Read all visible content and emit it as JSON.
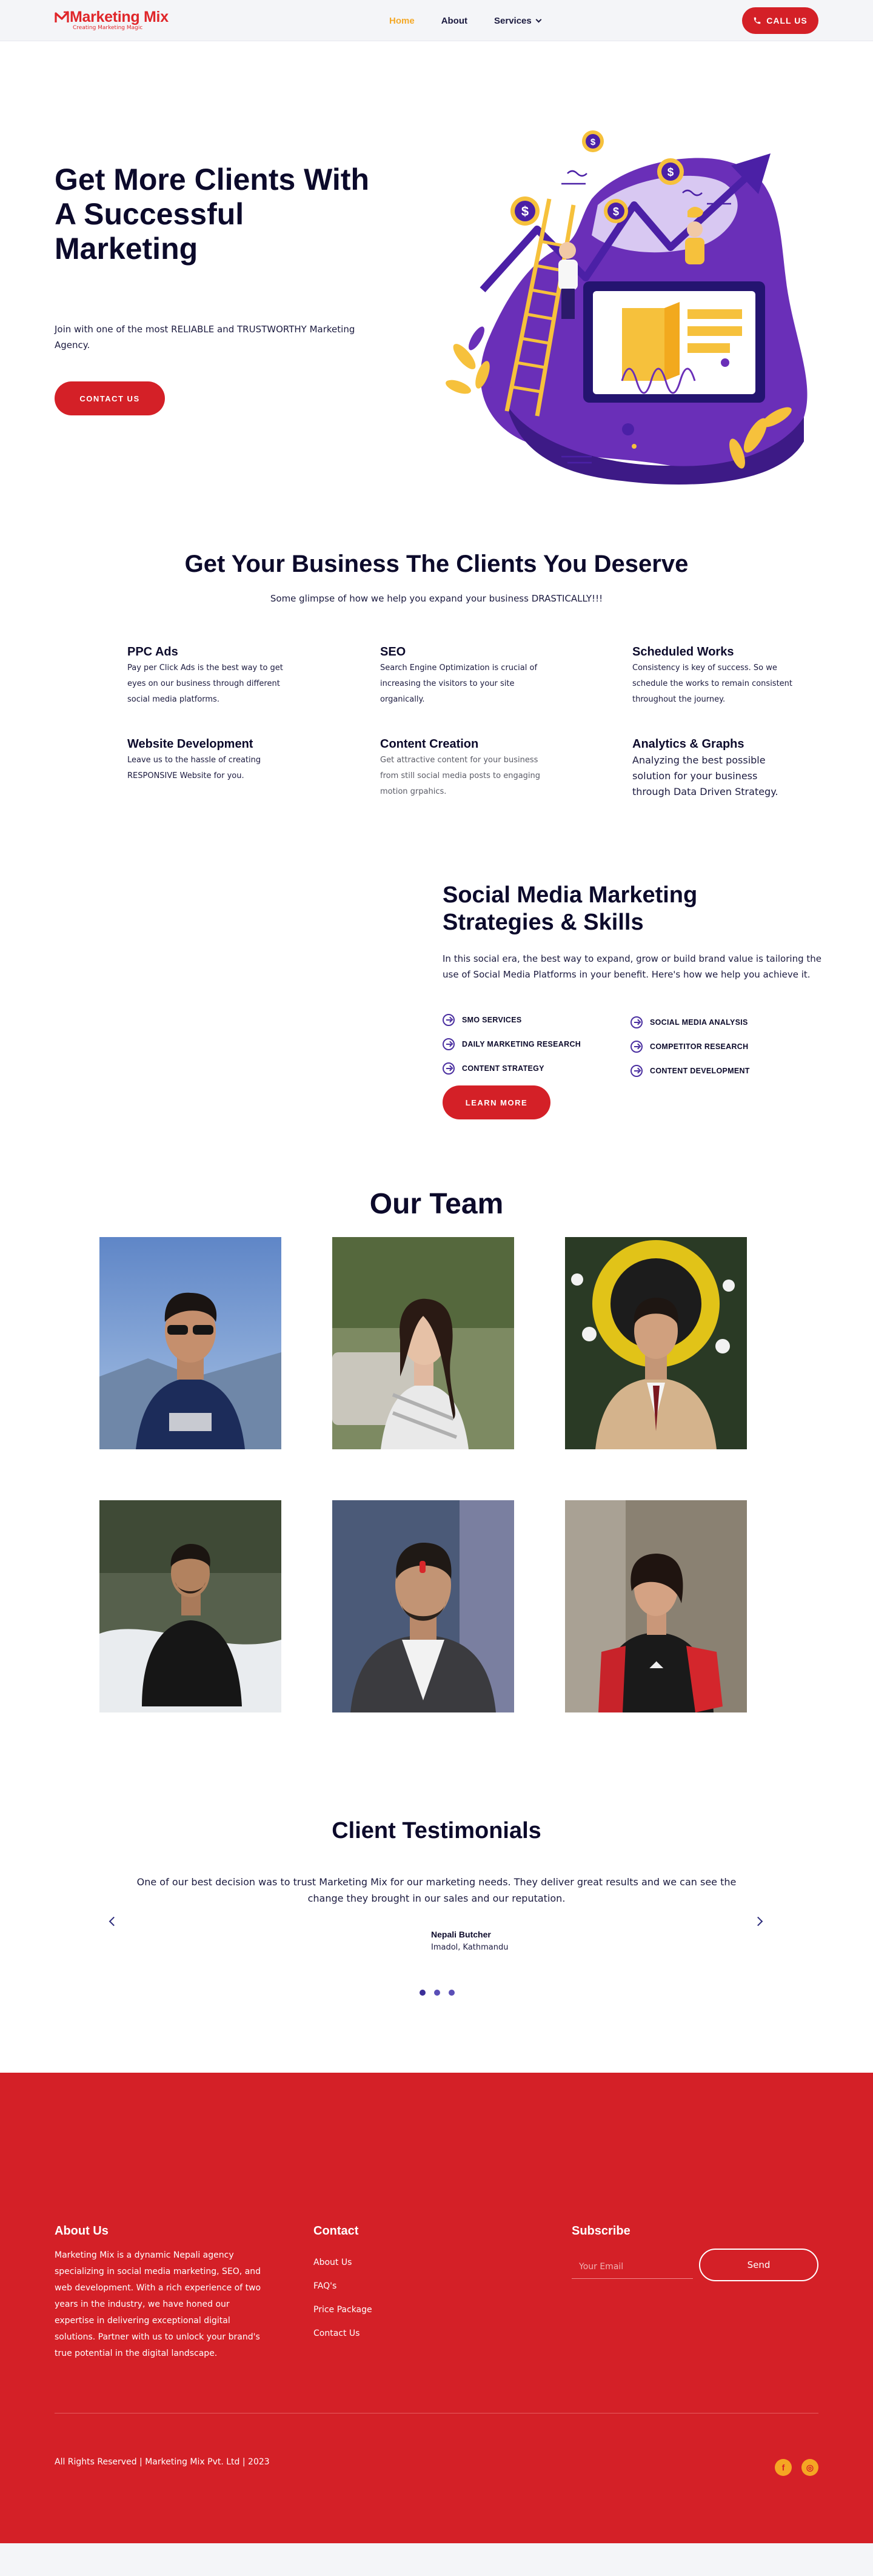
{
  "brand": {
    "name": "Marketing Mix",
    "tagline": "Creating Marketing Magic",
    "primary_color": "#d42027",
    "accent_color": "#f4a928",
    "navy_color": "#0c0a2b"
  },
  "nav": {
    "items": [
      {
        "label": "Home",
        "active": true
      },
      {
        "label": "About",
        "active": false
      },
      {
        "label": "Services",
        "active": false,
        "has_dropdown": true
      }
    ],
    "call_label": "CALL US",
    "call_icon": "phone-icon"
  },
  "hero": {
    "title": "Get More Clients With A Successful Marketing",
    "subtitle": "Join with one of the most RELIABLE and TRUSTWORTHY Marketing Agency.",
    "cta": "CONTACT US",
    "illustration": "marketing-growth-illustration"
  },
  "services": {
    "title": "Get Your Business The Clients You Deserve",
    "subtitle": "Some glimpse of how we help you expand your business DRASTICALLY!!!",
    "items": [
      {
        "title": "PPC Ads",
        "text": "Pay per Click Ads is the best way to get eyes on our business through different social media platforms."
      },
      {
        "title": "SEO",
        "text": "Search Engine Optimization is crucial of increasing the visitors to your site organically."
      },
      {
        "title": "Scheduled Works",
        "text": "Consistency is key of success. So we schedule the works to remain consistent throughout the journey."
      },
      {
        "title": "Website Development",
        "text": "Leave us to the hassle of creating RESPONSIVE Website for you."
      },
      {
        "title": "Content Creation",
        "text": "Get attractive content for your business from still social media posts to engaging motion grpahics."
      },
      {
        "title": "Analytics & Graphs",
        "text": "Analyzing the best possible solution for your business through Data Driven Strategy."
      }
    ]
  },
  "smm": {
    "title": "Social Media Marketing Strategies & Skills",
    "description": "In this social era, the best way to expand, grow or build brand value is tailoring the use of Social Media Platforms in your benefit. Here's how we help you achieve it.",
    "skills_left": [
      "SMO SERVICES",
      "DAILY MARKETING RESEARCH",
      "CONTENT STRATEGY"
    ],
    "skills_right": [
      "SOCIAL MEDIA ANALYSIS",
      "COMPETITOR RESEARCH",
      "CONTENT DEVELOPMENT"
    ],
    "cta": "LEARN MORE"
  },
  "team": {
    "title": "Our Team",
    "members": [
      {
        "photo": "team-photo-1"
      },
      {
        "photo": "team-photo-2"
      },
      {
        "photo": "team-photo-3"
      },
      {
        "photo": "team-photo-4"
      },
      {
        "photo": "team-photo-5"
      },
      {
        "photo": "team-photo-6"
      }
    ]
  },
  "testimonials": {
    "title": "Client Testimonials",
    "quote": "One of our best decision was to trust Marketing Mix for our marketing needs. They deliver great results and we can see the change they brought in our sales and our reputation.",
    "name": "Nepali Butcher",
    "place": "Imadol, Kathmandu",
    "slide_count": 3,
    "active_slide": 1
  },
  "footer": {
    "about_title": "About Us",
    "about_text": "Marketing Mix is a dynamic Nepali agency specializing in social media marketing, SEO, and web development. With a rich experience of two years in the industry, we have honed our expertise in delivering exceptional digital solutions. Partner with us to unlock your brand's true potential in the digital landscape.",
    "contact_title": "Contact",
    "links": [
      "About Us",
      "FAQ's",
      "Price Package",
      "Contact Us"
    ],
    "subscribe_title": "Subscribe",
    "email_placeholder": "Your Email",
    "send_label": "Send",
    "copyright": "All Rights Reserved | Marketing Mix Pvt. Ltd | 2023",
    "social": [
      {
        "icon": "facebook-icon",
        "glyph": "f"
      },
      {
        "icon": "instagram-icon",
        "glyph": "◎"
      }
    ]
  }
}
